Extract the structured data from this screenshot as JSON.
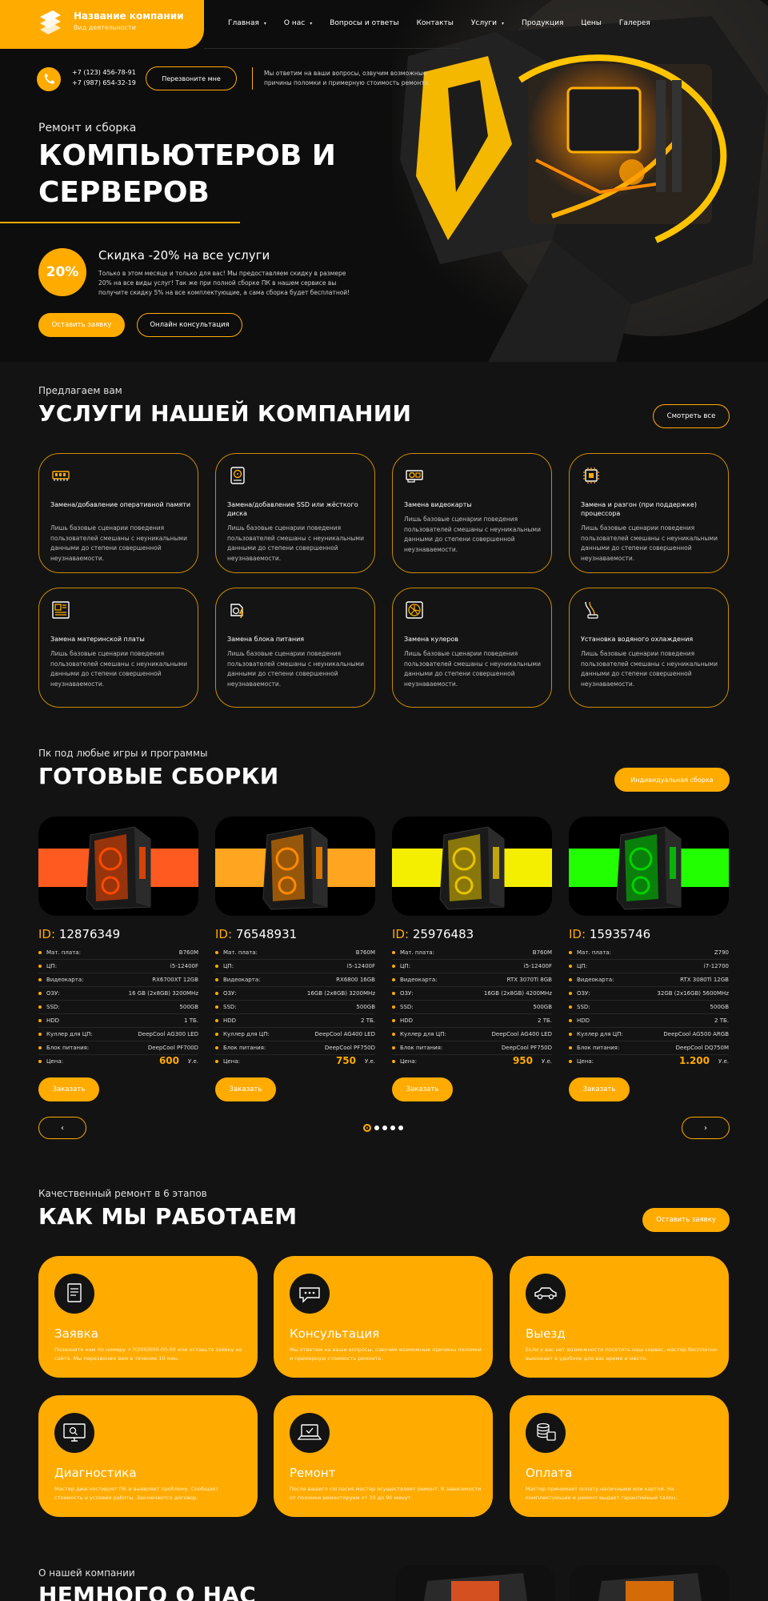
{
  "header": {
    "company_name": "Название компании",
    "company_sub": "Вид деятельности",
    "nav": [
      {
        "label": "Главная",
        "dropdown": true
      },
      {
        "label": "О нас",
        "dropdown": true
      },
      {
        "label": "Вопросы и ответы",
        "dropdown": false
      },
      {
        "label": "Контакты",
        "dropdown": false
      },
      {
        "label": "Услуги",
        "dropdown": true
      },
      {
        "label": "Продукция",
        "dropdown": false
      },
      {
        "label": "Цены",
        "dropdown": false
      },
      {
        "label": "Галерея",
        "dropdown": false
      }
    ],
    "phone1": "+7 (123) 456-78-91",
    "phone2": "+7 (987) 654-32-19",
    "callback_label": "Перезвоните мне",
    "info_text": "Мы ответим на ваши вопросы, озвучим возможные причины поломки и примерную стоимость ремонта."
  },
  "hero": {
    "pretitle": "Ремонт и сборка",
    "title_line1": "КОМПЬЮТЕРОВ И",
    "title_line2": "СЕРВЕРОВ",
    "discount_badge": "20%",
    "discount_title": "Скидка -20% на все услуги",
    "discount_text": "Только в этом месяце и только для вас! Мы предоставляем скидку в размере 20% на все виды услуг! Так же при полной сборке ПК в нашем сервисе вы получите скидку 5% на все комплектующие, а сама сборка будет бесплатной!",
    "btn_request": "Оставить заявку",
    "btn_consult": "Онлайн консультация"
  },
  "services": {
    "pretitle": "Предлагаем вам",
    "title": "УСЛУГИ НАШЕЙ КОМПАНИИ",
    "see_all": "Смотреть все",
    "items": [
      {
        "title": "Замена/добавление оперативной памяти",
        "text": "Лишь базовые сценарии поведения пользователей смешаны с неуникальными данными до степени совершенной неузнаваемости.",
        "icon": "ram-icon"
      },
      {
        "title": "Замена/добавление SSD или жёсткого диска",
        "text": "Лишь базовые сценарии поведения пользователей смешаны с неуникальными данными до степени совершенной неузнаваемости.",
        "icon": "hdd-icon"
      },
      {
        "title": "Замена видеокарты",
        "text": "Лишь базовые сценарии поведения пользователей смешаны с неуникальными данными до степени совершенной неузнаваемости.",
        "icon": "gpu-icon"
      },
      {
        "title": "Замена и разгон (при поддержке) процессора",
        "text": "Лишь базовые сценарии поведения пользователей смешаны с неуникальными данными до степени совершенной неузнаваемости.",
        "icon": "cpu-icon"
      },
      {
        "title": "Замена материнской платы",
        "text": "Лишь базовые сценарии поведения пользователей смешаны с неуникальными данными до степени совершенной неузнаваемости.",
        "icon": "motherboard-icon"
      },
      {
        "title": "Замена блока питания",
        "text": "Лишь базовые сценарии поведения пользователей смешаны с неуникальными данными до степени совершенной неузнаваемости.",
        "icon": "power-supply-icon"
      },
      {
        "title": "Замена кулеров",
        "text": "Лишь базовые сценарии поведения пользователей смешаны с неуникальными данными до степени совершенной неузнаваемости.",
        "icon": "fan-icon"
      },
      {
        "title": "Установка водяного охлаждения",
        "text": "Лишь базовые сценарии поведения пользователей смешаны с неуникальными данными до степени совершенной неузнаваемости.",
        "icon": "water-cooling-icon"
      }
    ]
  },
  "builds": {
    "pretitle": "Пк под любые игры и программы",
    "title": "ГОТОВЫЕ СБОРКИ",
    "custom_btn": "Индивидуальная сборка",
    "id_prefix": "ID:",
    "order_label": "Заказать",
    "currency": "У.е.",
    "prev": "‹",
    "next": "›",
    "items": [
      {
        "id": "12876349",
        "band": "#ff5a1f",
        "glow": "#ff4a00",
        "specs": [
          [
            "Мат. плата:",
            "B760M"
          ],
          [
            "ЦП:",
            "i5-12400F"
          ],
          [
            "Видеокарта:",
            "RX6700XT 12GB"
          ],
          [
            "ОЗУ:",
            "16 GB (2x8GB) 3200MHz"
          ],
          [
            "SSD:",
            "500GB"
          ],
          [
            "HDD",
            "1 ТБ."
          ],
          [
            "Куллер для ЦП:",
            "DeepCool AG300 LED"
          ],
          [
            "Блок питания:",
            "DeepCool PF700D"
          ]
        ],
        "price_label": "Цена:",
        "price": "600"
      },
      {
        "id": "76548931",
        "band": "#ffa51f",
        "glow": "#ff8a00",
        "specs": [
          [
            "Мат. плата:",
            "B760M"
          ],
          [
            "ЦП:",
            "i5-12400F"
          ],
          [
            "Видеокарта:",
            "RX6800 16GB"
          ],
          [
            "ОЗУ:",
            "16GB (2x8GB) 3200MHz"
          ],
          [
            "SSD:",
            "500GB"
          ],
          [
            "HDD",
            "2 ТБ."
          ],
          [
            "Куллер для ЦП:",
            "DeepCool AG400 LED"
          ],
          [
            "Блок питания:",
            "DeepCool PF750D"
          ]
        ],
        "price_label": "Цена:",
        "price": "750"
      },
      {
        "id": "25976483",
        "band": "#f4ef00",
        "glow": "#e8c400",
        "specs": [
          [
            "Мат. плата:",
            "B760M"
          ],
          [
            "ЦП:",
            "i5-12400F"
          ],
          [
            "Видеокарта:",
            "RTX 3070Ti 8GB"
          ],
          [
            "ОЗУ:",
            "16GB (2x8GB) 4200MHz"
          ],
          [
            "SSD:",
            "500GB"
          ],
          [
            "HDD",
            "2 ТБ."
          ],
          [
            "Куллер для ЦП:",
            "DeepCool AG400 LED"
          ],
          [
            "Блок питания:",
            "DeepCool PF750D"
          ]
        ],
        "price_label": "Цена:",
        "price": "950"
      },
      {
        "id": "15935746",
        "band": "#22ff00",
        "glow": "#00d400",
        "specs": [
          [
            "Мат. плата:",
            "Z790"
          ],
          [
            "ЦП:",
            "i7-12700"
          ],
          [
            "Видеокарта:",
            "RTX 3080Ti 12GB"
          ],
          [
            "ОЗУ:",
            "32GB (2x16GB) 5600MHz"
          ],
          [
            "SSD:",
            "500GB"
          ],
          [
            "HDD",
            "2 ТБ."
          ],
          [
            "Куллер для ЦП:",
            "DeepCool AG500 ARGB"
          ],
          [
            "Блок питания:",
            "DeepCool DQ750M"
          ]
        ],
        "price_label": "Цена:",
        "price": "1.200"
      }
    ]
  },
  "steps": {
    "pretitle": "Качественный ремонт в 6 этапов",
    "title": "КАК МЫ РАБОТАЕМ",
    "btn": "Оставить заявку",
    "items": [
      {
        "title": "Заявка",
        "text": "Позвоните нам по номеру +7(000)000-00-00 или оставьте заявку на сайте. Мы перезвоним вам в течение 10 мин.",
        "icon": "document-icon"
      },
      {
        "title": "Консультация",
        "text": "Мы ответим на ваши вопросы, озвучим возможные причины поломки и примерную стоимость ремонта.",
        "icon": "chat-icon"
      },
      {
        "title": "Выезд",
        "text": "Если у вас нет возможности посетить наш сервис, мастер бесплатно выезжает в удобное для вас время и место.",
        "icon": "car-icon"
      },
      {
        "title": "Диагностика",
        "text": "Мастер диагностирует ПК и выявляет проблему. Сообщает стоимость и условия работы. Заключается договор.",
        "icon": "monitor-icon"
      },
      {
        "title": "Ремонт",
        "text": "После вашего согласия мастер осуществляет ремонт. В зависимости от поломки ремонтируем от 30 до 90 минут.",
        "icon": "laptop-icon"
      },
      {
        "title": "Оплата",
        "text": "Мастер принимает оплату наличными или картой. На комплектующие и ремонт выдает гарантийный талон.",
        "icon": "coins-icon"
      }
    ]
  },
  "about": {
    "pretitle": "О нашей компании",
    "title": "НЕМНОГО О НАС"
  },
  "colors": {
    "accent": "#ffab00",
    "background": "#131313"
  }
}
